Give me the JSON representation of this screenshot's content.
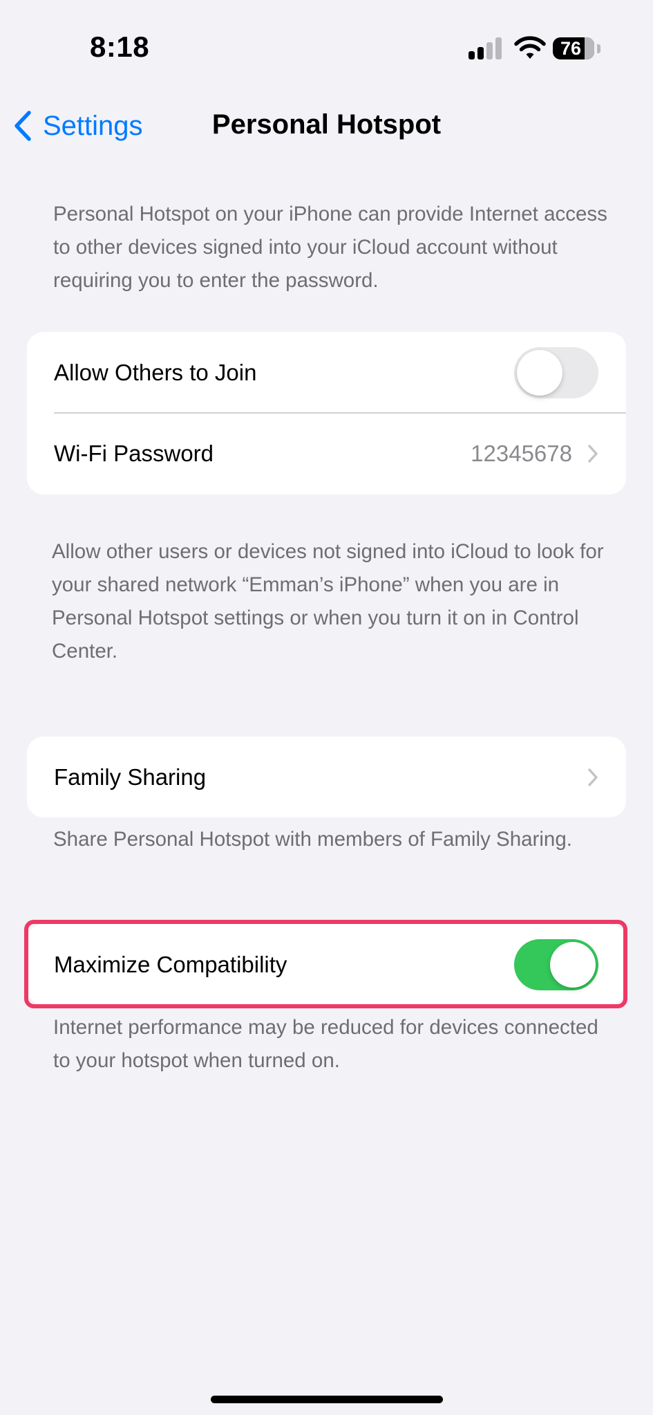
{
  "status_bar": {
    "time": "8:18",
    "battery_level": "76",
    "battery_fraction": 0.76,
    "icons": [
      "cellular-signal-icon",
      "wifi-icon",
      "battery-icon"
    ]
  },
  "nav": {
    "back_label": "Settings",
    "back_icon": "chevron-left-icon",
    "title": "Personal Hotspot"
  },
  "intro_text": "Personal Hotspot on your iPhone can provide Internet access to other devices signed into your iCloud account without requiring you to enter the password.",
  "join_group": {
    "allow_others_label": "Allow Others to Join",
    "allow_others_on": false,
    "wifi_password_label": "Wi-Fi Password",
    "wifi_password_value": "12345678",
    "footer": "Allow other users or devices not signed into iCloud to look for your shared network “Emman’s iPhone” when you are in Personal Hotspot settings or when you turn it on in Control Center."
  },
  "family_group": {
    "label": "Family Sharing",
    "footer": "Share Personal Hotspot with members of Family Sharing."
  },
  "compat_group": {
    "label": "Maximize Compatibility",
    "on": true,
    "footer": "Internet performance may be reduced for devices connected to your hotspot when turned on."
  },
  "colors": {
    "accent": "#007aff",
    "toggle_on": "#34c759",
    "toggle_off": "#e9e9eb",
    "highlight": "#ee3965",
    "background": "#f2f2f7"
  }
}
